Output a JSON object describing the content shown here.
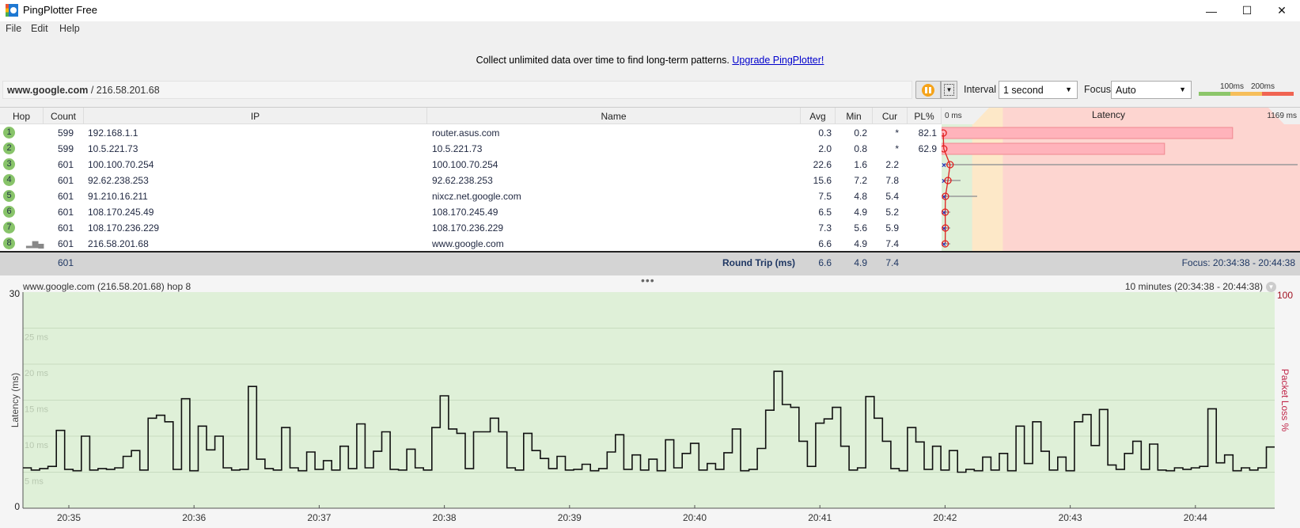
{
  "window": {
    "title": "PingPlotter Free",
    "controls": {
      "minimize": "—",
      "maximize": "☐",
      "close": "✕"
    }
  },
  "menu": [
    "File",
    "Edit",
    "Help"
  ],
  "banner": {
    "text": "Collect unlimited data over time to find long-term patterns.",
    "link": "Upgrade PingPlotter!"
  },
  "target": {
    "host": "www.google.com",
    "ip": "/ 216.58.201.68"
  },
  "toolbar": {
    "interval_label": "Interval",
    "interval_value": "1 second",
    "focus_label": "Focus",
    "focus_value": "Auto",
    "legend": {
      "low": "100ms",
      "high": "200ms",
      "colors": [
        "#8cc66a",
        "#f6be5a",
        "#f06452"
      ]
    }
  },
  "table": {
    "columns": [
      "Hop",
      "Count",
      "IP",
      "Name",
      "Avg",
      "Min",
      "Cur",
      "PL%",
      "Latency"
    ],
    "latency_min_label": "0 ms",
    "latency_max_label": "1169 ms",
    "hops": [
      {
        "hop": "1",
        "count": "599",
        "ip": "192.168.1.1",
        "name": "router.asus.com",
        "avg": "0.3",
        "min": "0.2",
        "cur": "*",
        "pl": "82.1"
      },
      {
        "hop": "2",
        "count": "599",
        "ip": "10.5.221.73",
        "name": "10.5.221.73",
        "avg": "2.0",
        "min": "0.8",
        "cur": "*",
        "pl": "62.9"
      },
      {
        "hop": "3",
        "count": "601",
        "ip": "100.100.70.254",
        "name": "100.100.70.254",
        "avg": "22.6",
        "min": "1.6",
        "cur": "2.2",
        "pl": ""
      },
      {
        "hop": "4",
        "count": "601",
        "ip": "92.62.238.253",
        "name": "92.62.238.253",
        "avg": "15.6",
        "min": "7.2",
        "cur": "7.8",
        "pl": ""
      },
      {
        "hop": "5",
        "count": "601",
        "ip": "91.210.16.211",
        "name": "nixcz.net.google.com",
        "avg": "7.5",
        "min": "4.8",
        "cur": "5.4",
        "pl": ""
      },
      {
        "hop": "6",
        "count": "601",
        "ip": "108.170.245.49",
        "name": "108.170.245.49",
        "avg": "6.5",
        "min": "4.9",
        "cur": "5.2",
        "pl": ""
      },
      {
        "hop": "7",
        "count": "601",
        "ip": "108.170.236.229",
        "name": "108.170.236.229",
        "avg": "7.3",
        "min": "5.6",
        "cur": "5.9",
        "pl": ""
      },
      {
        "hop": "8",
        "count": "601",
        "ip": "216.58.201.68",
        "name": "www.google.com",
        "avg": "6.6",
        "min": "4.9",
        "cur": "7.4",
        "pl": ""
      }
    ],
    "summary": {
      "count": "601",
      "label": "Round Trip (ms)",
      "avg": "6.6",
      "min": "4.9",
      "cur": "7.4",
      "focus": "Focus: 20:34:38 - 20:44:38"
    }
  },
  "chart_data": {
    "type": "line",
    "title": "www.google.com (216.58.201.68) hop 8",
    "range_label": "10 minutes (20:34:38 - 20:44:38)",
    "ylabel": "Latency (ms)",
    "y2label": "Packet Loss %",
    "y2_max_label": "100",
    "ylim": [
      0,
      30
    ],
    "y_axis_end_labels": [
      "0",
      "30"
    ],
    "gridline_labels": [
      "5 ms",
      "10 ms",
      "15 ms",
      "20 ms",
      "25 ms"
    ],
    "gridline_values": [
      5,
      10,
      15,
      20,
      25
    ],
    "x_start": "20:34:38",
    "x_end": "20:44:38",
    "x_ticks": [
      "20:35",
      "20:36",
      "20:37",
      "20:38",
      "20:39",
      "20:40",
      "20:41",
      "20:42",
      "20:43",
      "20:44"
    ],
    "background_color": "#dff0d8",
    "sample_interval_s": 4,
    "series": [
      {
        "values": [
          5.6,
          5.3,
          5.5,
          5.8,
          10.8,
          5.4,
          5.2,
          10.0,
          5.3,
          5.5,
          5.4,
          5.6,
          7.2,
          8.0,
          5.3,
          12.5,
          12.9,
          12.0,
          5.4,
          15.2,
          5.2,
          11.4,
          8.1,
          10.0,
          5.6,
          5.3,
          5.4,
          16.9,
          6.8,
          5.5,
          5.3,
          11.2,
          5.6,
          5.2,
          7.8,
          5.4,
          6.6,
          5.3,
          8.6,
          5.5,
          11.7,
          5.6,
          7.9,
          10.6,
          5.4,
          5.3,
          8.2,
          5.6,
          5.3,
          11.2,
          15.6,
          11.0,
          10.4,
          5.5,
          10.6,
          10.6,
          12.5,
          10.6,
          5.6,
          5.3,
          10.4,
          8.0,
          6.9,
          5.5,
          7.2,
          5.3,
          5.4,
          6.1,
          5.2,
          5.5,
          7.8,
          10.2,
          5.4,
          7.4,
          5.3,
          6.8,
          5.2,
          9.5,
          5.6,
          7.6,
          9.0,
          5.3,
          6.2,
          5.4,
          7.7,
          11.0,
          5.2,
          5.4,
          8.3,
          13.6,
          19.0,
          14.4,
          14.0,
          9.3,
          5.8,
          11.8,
          12.4,
          14.0,
          8.6,
          5.3,
          5.6,
          15.5,
          12.5,
          9.3,
          5.5,
          5.2,
          11.2,
          9.2,
          5.4,
          8.6,
          5.3,
          8.0,
          5.0,
          5.4,
          5.2,
          7.1,
          5.3,
          7.6,
          5.2,
          11.4,
          6.2,
          12.0,
          7.9,
          5.3,
          7.1,
          5.2,
          12.0,
          13.0,
          8.7,
          13.7,
          6.0,
          5.4,
          7.6,
          9.3,
          5.4,
          8.9,
          5.3,
          5.2,
          5.6,
          5.4,
          5.6,
          5.8,
          13.8,
          6.3,
          7.4,
          5.2,
          5.6,
          5.3,
          5.6,
          8.5
        ]
      }
    ]
  }
}
